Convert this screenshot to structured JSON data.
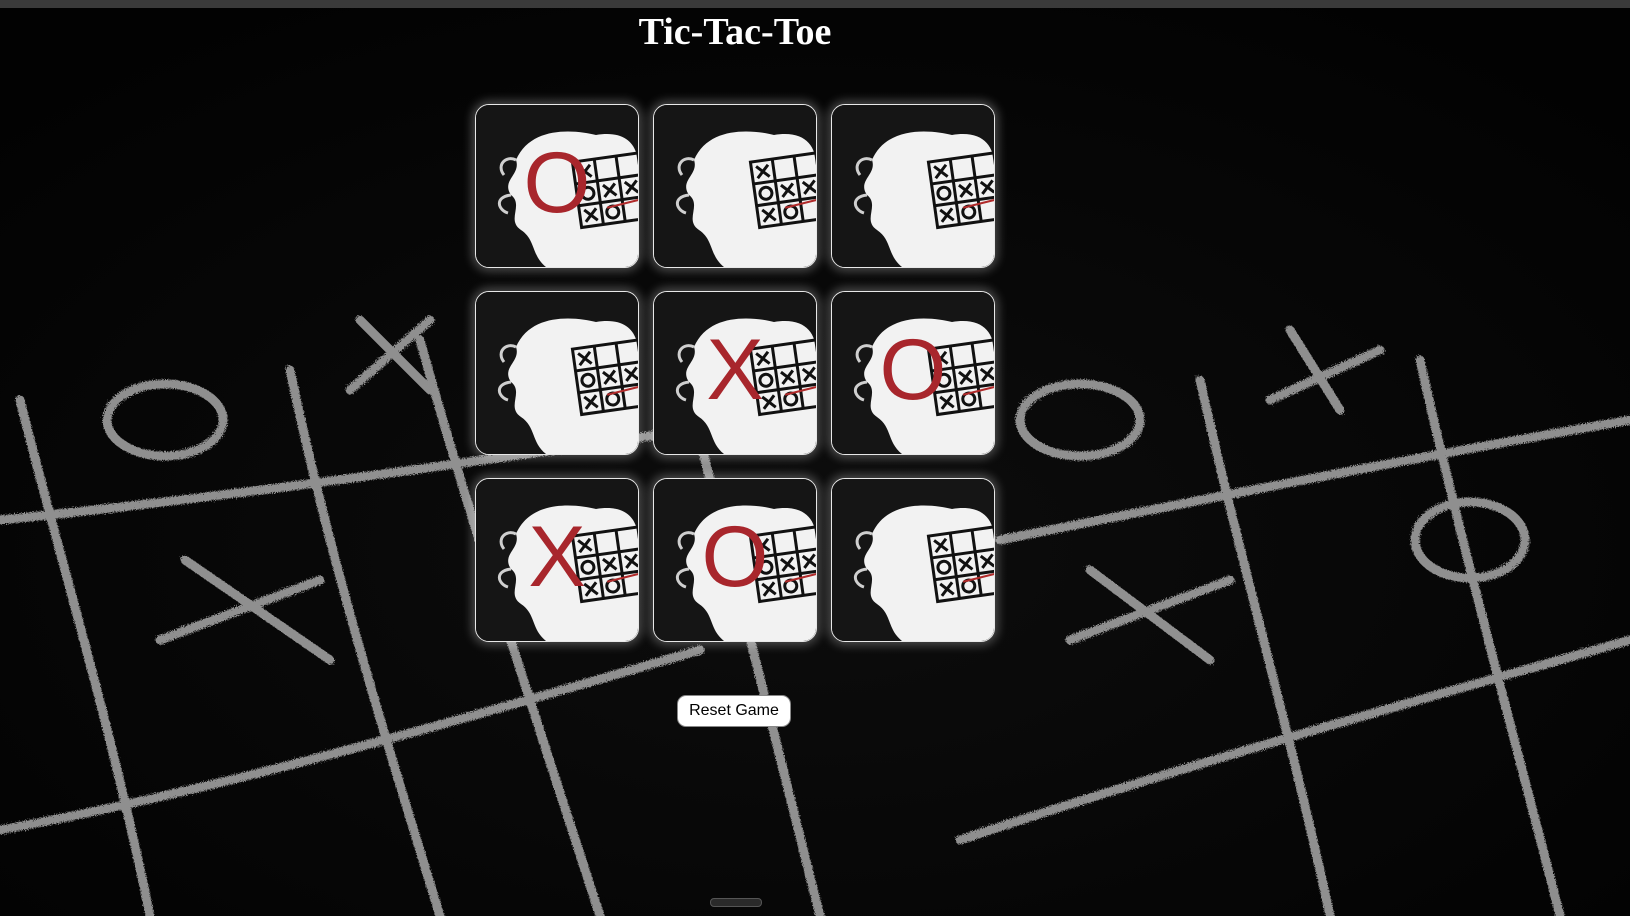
{
  "page": {
    "title": "Tic-Tac-Toe"
  },
  "board": {
    "cells": [
      {
        "mark": "O"
      },
      {
        "mark": ""
      },
      {
        "mark": ""
      },
      {
        "mark": ""
      },
      {
        "mark": "X"
      },
      {
        "mark": "O"
      },
      {
        "mark": "X"
      },
      {
        "mark": "O"
      },
      {
        "mark": ""
      }
    ]
  },
  "controls": {
    "reset_label": "Reset Game"
  },
  "colors": {
    "mark": "#a8262c",
    "background": "#070707",
    "title": "#ffffff"
  },
  "icons": {
    "tile": "tic-tac-toe-splash-icon"
  }
}
